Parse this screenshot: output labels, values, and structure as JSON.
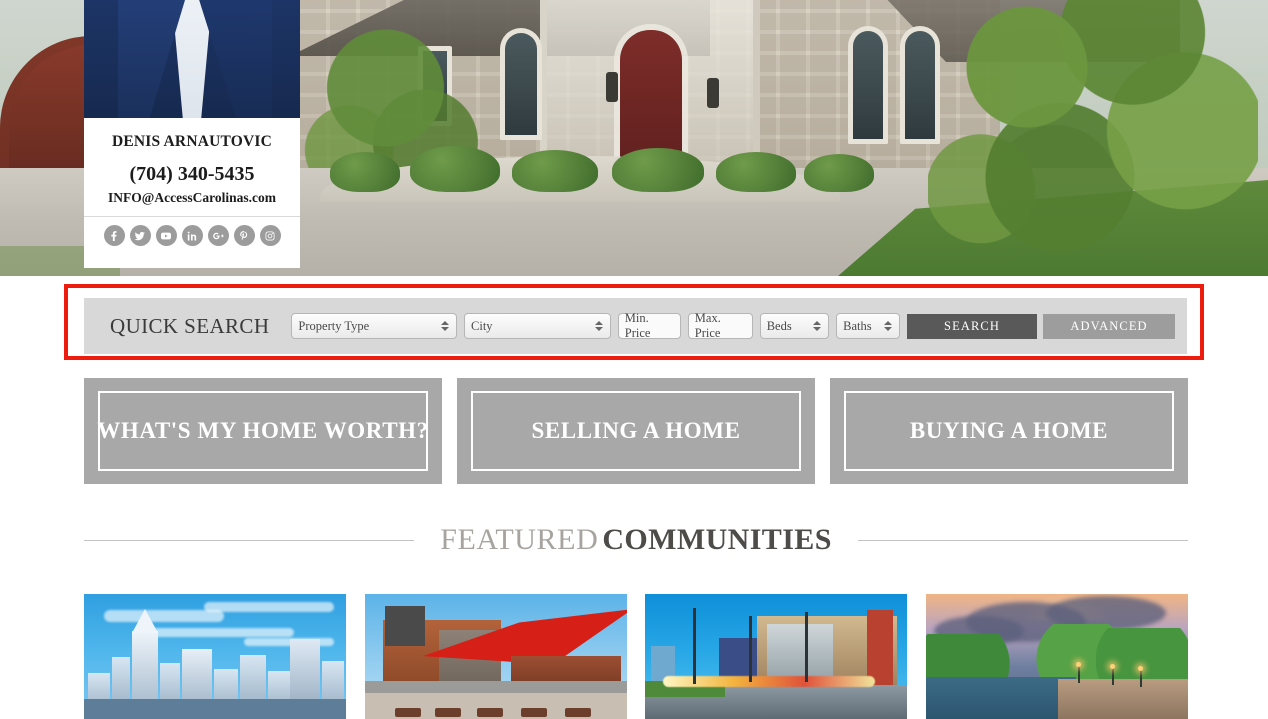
{
  "agent": {
    "name": "DENIS ARNAUTOVIC",
    "phone": "(704) 340-5435",
    "email": "INFO@AccessCarolinas.com",
    "social": [
      {
        "name": "facebook-icon",
        "label": "Facebook"
      },
      {
        "name": "twitter-icon",
        "label": "Twitter"
      },
      {
        "name": "youtube-icon",
        "label": "YouTube"
      },
      {
        "name": "linkedin-icon",
        "label": "LinkedIn"
      },
      {
        "name": "google-plus-icon",
        "label": "Google Plus"
      },
      {
        "name": "pinterest-icon",
        "label": "Pinterest"
      },
      {
        "name": "instagram-icon",
        "label": "Instagram"
      }
    ]
  },
  "quick_search": {
    "title": "QUICK SEARCH",
    "property_type": "Property Type",
    "city": "City",
    "min_price": "Min. Price",
    "max_price": "Max. Price",
    "beds": "Beds",
    "baths": "Baths",
    "search_button": "SEARCH",
    "advanced_button": "ADVANCED",
    "highlight_color": "#ee1b0f",
    "search_button_color": "#595959",
    "advanced_button_color": "#9d9d9d",
    "panel_color": "#d8d8d8"
  },
  "cta_boxes": [
    {
      "label": "WHAT'S MY HOME WORTH?"
    },
    {
      "label": "SELLING A HOME"
    },
    {
      "label": "BUYING A HOME"
    }
  ],
  "featured": {
    "title_light": "FEATURED",
    "title_bold": "COMMUNITIES"
  },
  "communities": [
    {
      "name": "charlotte-skyline-thumbnail"
    },
    {
      "name": "plaza-red-sail-thumbnail"
    },
    {
      "name": "light-rail-dusk-thumbnail"
    },
    {
      "name": "park-lake-dusk-thumbnail"
    }
  ]
}
